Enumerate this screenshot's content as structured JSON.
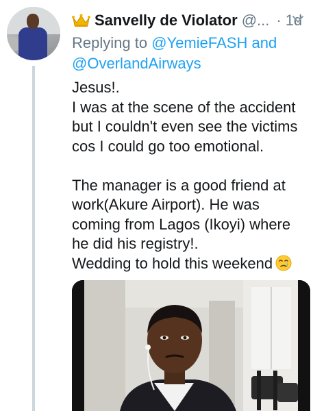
{
  "tweet": {
    "author_name": "Sanvelly de Violator",
    "handle": "@...",
    "time_separator": "·",
    "time": "1d",
    "replying_prefix": "Replying to",
    "replying_to_1": "@YemieFASH",
    "replying_and": "and",
    "replying_to_2": "@OverlandAirways",
    "body_lines": [
      "Jesus!.",
      "I was at the scene of the accident but I couldn't even see the victims cos I could go too emotional.",
      "The manager is a good friend at work(Akure Airport). He was coming from Lagos (Ikoyi) where he did his registry!.",
      "Wedding to hold this weekend"
    ],
    "emoji": "crying-face-emoji",
    "badge_icon": "crown-icon",
    "menu_icon": "chevron-down-icon"
  },
  "colors": {
    "link": "#1da1f2",
    "muted": "#657786",
    "text": "#14171a",
    "thread_line": "#ccd6dd"
  }
}
